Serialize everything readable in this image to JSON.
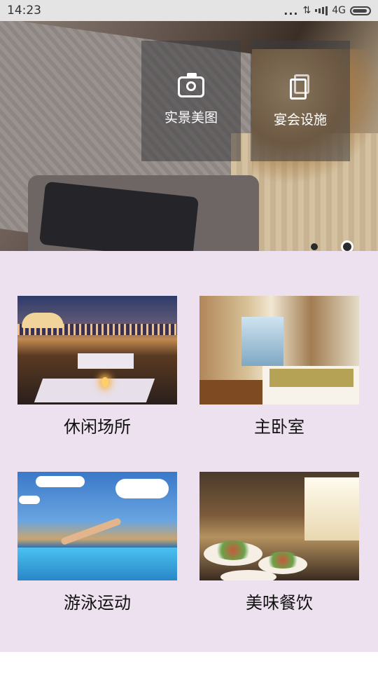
{
  "status_bar": {
    "time": "14:23",
    "network": "4G",
    "indicators": "..."
  },
  "hero": {
    "buttons": [
      {
        "label": "实景美图",
        "icon": "camera-icon"
      },
      {
        "label": "宴会设施",
        "icon": "copy-icon"
      }
    ],
    "pagination": {
      "count": 2,
      "active_index": 1
    }
  },
  "grid": {
    "items": [
      {
        "label": "休闲场所"
      },
      {
        "label": "主卧室"
      },
      {
        "label": "游泳运动"
      },
      {
        "label": "美味餐饮"
      }
    ]
  },
  "colors": {
    "grid_background": "#ede0ef",
    "status_bar_background": "#e4e4e4"
  }
}
